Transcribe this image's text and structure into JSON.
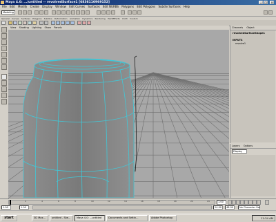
{
  "window": {
    "title": "Maya 4.0: .../untitled -- revolvedSurface1 [6836116969152]",
    "minimize_label": "_",
    "maximize_label": "□",
    "close_label": "×"
  },
  "menubar": {
    "items": [
      "File",
      "Edit",
      "Modify",
      "Create",
      "Display",
      "Window",
      "Edit Curves",
      "Surfaces",
      "Edit NURBS",
      "Polygons",
      "Edit Polygons",
      "Subdiv Surfaces",
      "Help"
    ]
  },
  "statusline": {
    "mode": "Modeling"
  },
  "shelf": {
    "tabs": [
      "General",
      "Curves",
      "Surfaces",
      "Polygons",
      "Subdivs",
      "Deformation",
      "Animation",
      "Dynamics",
      "Rendering",
      "PaintEffects",
      "Cloth",
      "Custom"
    ]
  },
  "viewport": {
    "menu": [
      "View",
      "Shading",
      "Lighting",
      "Show",
      "Panels"
    ],
    "colors": {
      "background": "#a8a8a8",
      "grid": "#6e6e6e",
      "wire": "#40c8d8"
    }
  },
  "channelbox": {
    "tabs": [
      "Channels",
      "Object"
    ],
    "title": "revolvedSurfaceShape1",
    "section": "INPUTS",
    "item": "revolve1"
  },
  "layereditor": {
    "tabs": [
      "Layers",
      "Options"
    ],
    "type": "Display"
  },
  "timeslider": {
    "ticks": [
      "2",
      "4",
      "6",
      "8",
      "10",
      "12",
      "14",
      "16",
      "18",
      "20",
      "22",
      "24"
    ],
    "current_frame": "1.00"
  },
  "rangeslider": {
    "start": "1.00",
    "start_inner": "1.00",
    "end_inner": "24.00",
    "end": "48.00",
    "character_set": "No Character Set"
  },
  "taskbar": {
    "start": "start",
    "tasks": [
      "3D Max...",
      "untitled - Ske...",
      "Maya 4.0: ...untitled",
      "Documents and Settin...",
      "Adobe Photoshop"
    ],
    "clock": "11:34 AM"
  }
}
